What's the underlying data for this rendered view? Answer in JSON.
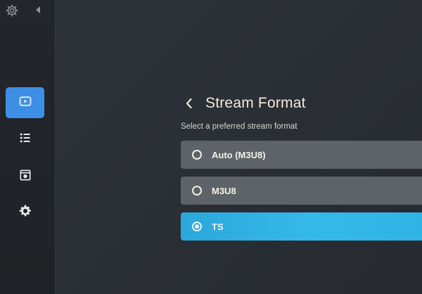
{
  "icons": {
    "top_settings": "gear-icon",
    "collapse": "triangle-left-icon",
    "back": "chevron-left-icon"
  },
  "sidebar": {
    "items": [
      {
        "icon": "play-video-icon",
        "active": true
      },
      {
        "icon": "list-icon",
        "active": false
      },
      {
        "icon": "media-window-icon",
        "active": false
      },
      {
        "icon": "gear-icon",
        "active": false
      }
    ]
  },
  "page": {
    "title": "Stream Format",
    "subtitle": "Select a preferred stream format"
  },
  "options": [
    {
      "label": "Auto (M3U8)",
      "selected": false
    },
    {
      "label": "M3U8",
      "selected": false
    },
    {
      "label": "TS",
      "selected": true
    }
  ],
  "colors": {
    "active_nav": "#3d8fe6",
    "selected_option": "#2fb3e4",
    "option_background": "#5d6368",
    "title_text": "#f4ead8"
  }
}
